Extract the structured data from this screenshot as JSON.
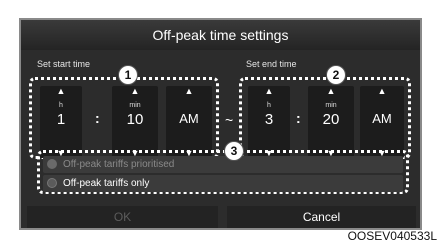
{
  "dialog": {
    "title": "Off-peak time settings",
    "start_label": "Set start time",
    "end_label": "Set end time",
    "separator": "~"
  },
  "start": {
    "hour_unit": "h",
    "hour": "1",
    "min_unit": "min",
    "minute": "10",
    "ampm": "AM"
  },
  "end": {
    "hour_unit": "h",
    "hour": "3",
    "min_unit": "min",
    "minute": "20",
    "ampm": "AM"
  },
  "options": {
    "prioritised": "Off-peak tariffs prioritised",
    "only": "Off-peak tariffs only"
  },
  "buttons": {
    "ok": "OK",
    "cancel": "Cancel"
  },
  "callouts": {
    "one": "1",
    "two": "2",
    "three": "3"
  },
  "figure_code": "OOSEV040533L"
}
